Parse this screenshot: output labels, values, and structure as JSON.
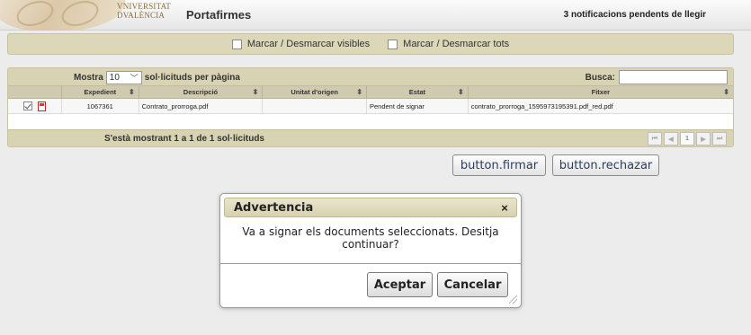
{
  "header": {
    "logo_line1": "VNIVERSITAT",
    "logo_line2": "DVALÈNCIA",
    "app_title": "Portafirmes",
    "notifications": "3 notificacions pendents de llegir"
  },
  "bulk_bar": {
    "mark_visible_label": "Marcar / Desmarcar visibles",
    "mark_all_label": "Marcar / Desmarcar tots"
  },
  "table": {
    "length_prefix": "Mostra",
    "length_value": "10",
    "length_suffix": "sol·licituds per pàgina",
    "search_label": "Busca:",
    "search_value": "",
    "columns": [
      "",
      "Expedient",
      "Descripció",
      "Unitat d'origen",
      "Estat",
      "Fitxer"
    ],
    "rows": [
      {
        "expedient": "1067361",
        "descripcio": "Contrato_prorroga.pdf",
        "unitat": "",
        "estat": "Pendent de signar",
        "fitxer": "contrato_prorroga_1595973195391.pdf_red.pdf"
      }
    ],
    "info": "S'està mostrant 1 a 1 de 1 sol·licituds",
    "pager": {
      "first": "⏮",
      "prev": "◀",
      "page": "1",
      "next": "▶",
      "last": "⏭"
    }
  },
  "actions": {
    "firmar_label": "button.firmar",
    "rechazar_label": "button.rechazar"
  },
  "dialog": {
    "title": "Advertencia",
    "close": "×",
    "message": "Va a signar els documents seleccionats. Desitja continuar?",
    "accept_label": "Aceptar",
    "cancel_label": "Cancelar"
  }
}
